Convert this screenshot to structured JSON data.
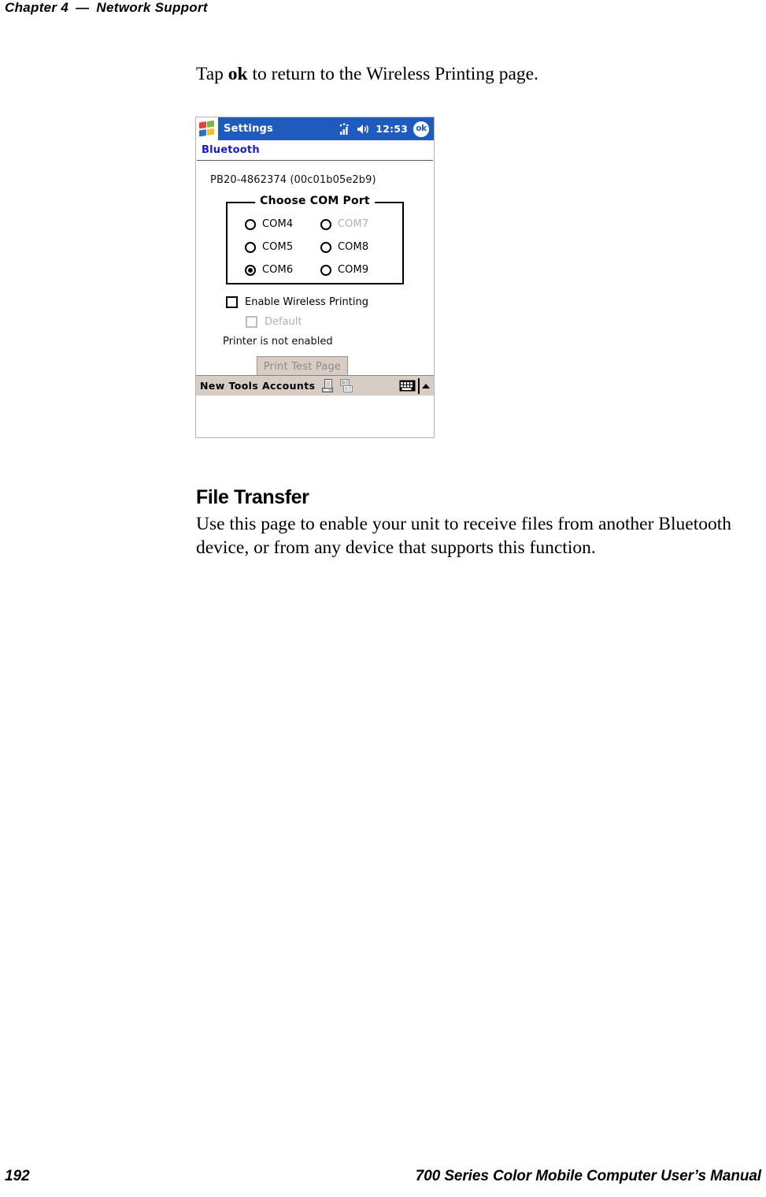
{
  "header": {
    "chapter": "Chapter 4",
    "dash": "—",
    "title": "Network Support"
  },
  "intro": {
    "text_before": "Tap ",
    "bold_word": "ok",
    "text_after": " to return to the Wireless Printing page."
  },
  "screenshot": {
    "titlebar": {
      "app_title": "Settings",
      "signal_icon": "signal-bars-icon",
      "speaker_icon": "speaker-icon",
      "clock": "12:53",
      "ok_label": "ok"
    },
    "page_title": "Bluetooth",
    "device_id": "PB20-4862374 (00c01b05e2b9)",
    "com_group": {
      "legend": "Choose COM Port",
      "options": [
        {
          "label": "COM4",
          "selected": false,
          "disabled": false
        },
        {
          "label": "COM7",
          "selected": false,
          "disabled": true
        },
        {
          "label": "COM5",
          "selected": false,
          "disabled": false
        },
        {
          "label": "COM8",
          "selected": false,
          "disabled": false
        },
        {
          "label": "COM6",
          "selected": true,
          "disabled": false
        },
        {
          "label": "COM9",
          "selected": false,
          "disabled": false
        }
      ]
    },
    "checkboxes": {
      "enable_wireless_printing": "Enable Wireless Printing",
      "default": "Default"
    },
    "status": "Printer is not enabled",
    "test_button": "Print Test Page",
    "commandbar": {
      "new": "New",
      "tools": "Tools",
      "accounts": "Accounts",
      "menu_text": "New Tools Accounts",
      "icon1": "printer-device-icon",
      "icon2": "document-list-icon",
      "sip_icon": "keyboard-icon",
      "sip_arrow_icon": "chevron-up-icon"
    },
    "colors": {
      "titlebar_blue": "#1f5bbf",
      "page_title_blue": "#1a1ad0",
      "cmdbar_beige": "#d7cdc5",
      "disabled_gray": "#b0b0b0"
    }
  },
  "section": {
    "heading": "File Transfer",
    "paragraph": "Use this page to enable your unit to receive files from another Bluetooth device, or from any device that supports this function."
  },
  "footer": {
    "page_number": "192",
    "manual_title": "700 Series Color Mobile Computer User’s Manual"
  }
}
